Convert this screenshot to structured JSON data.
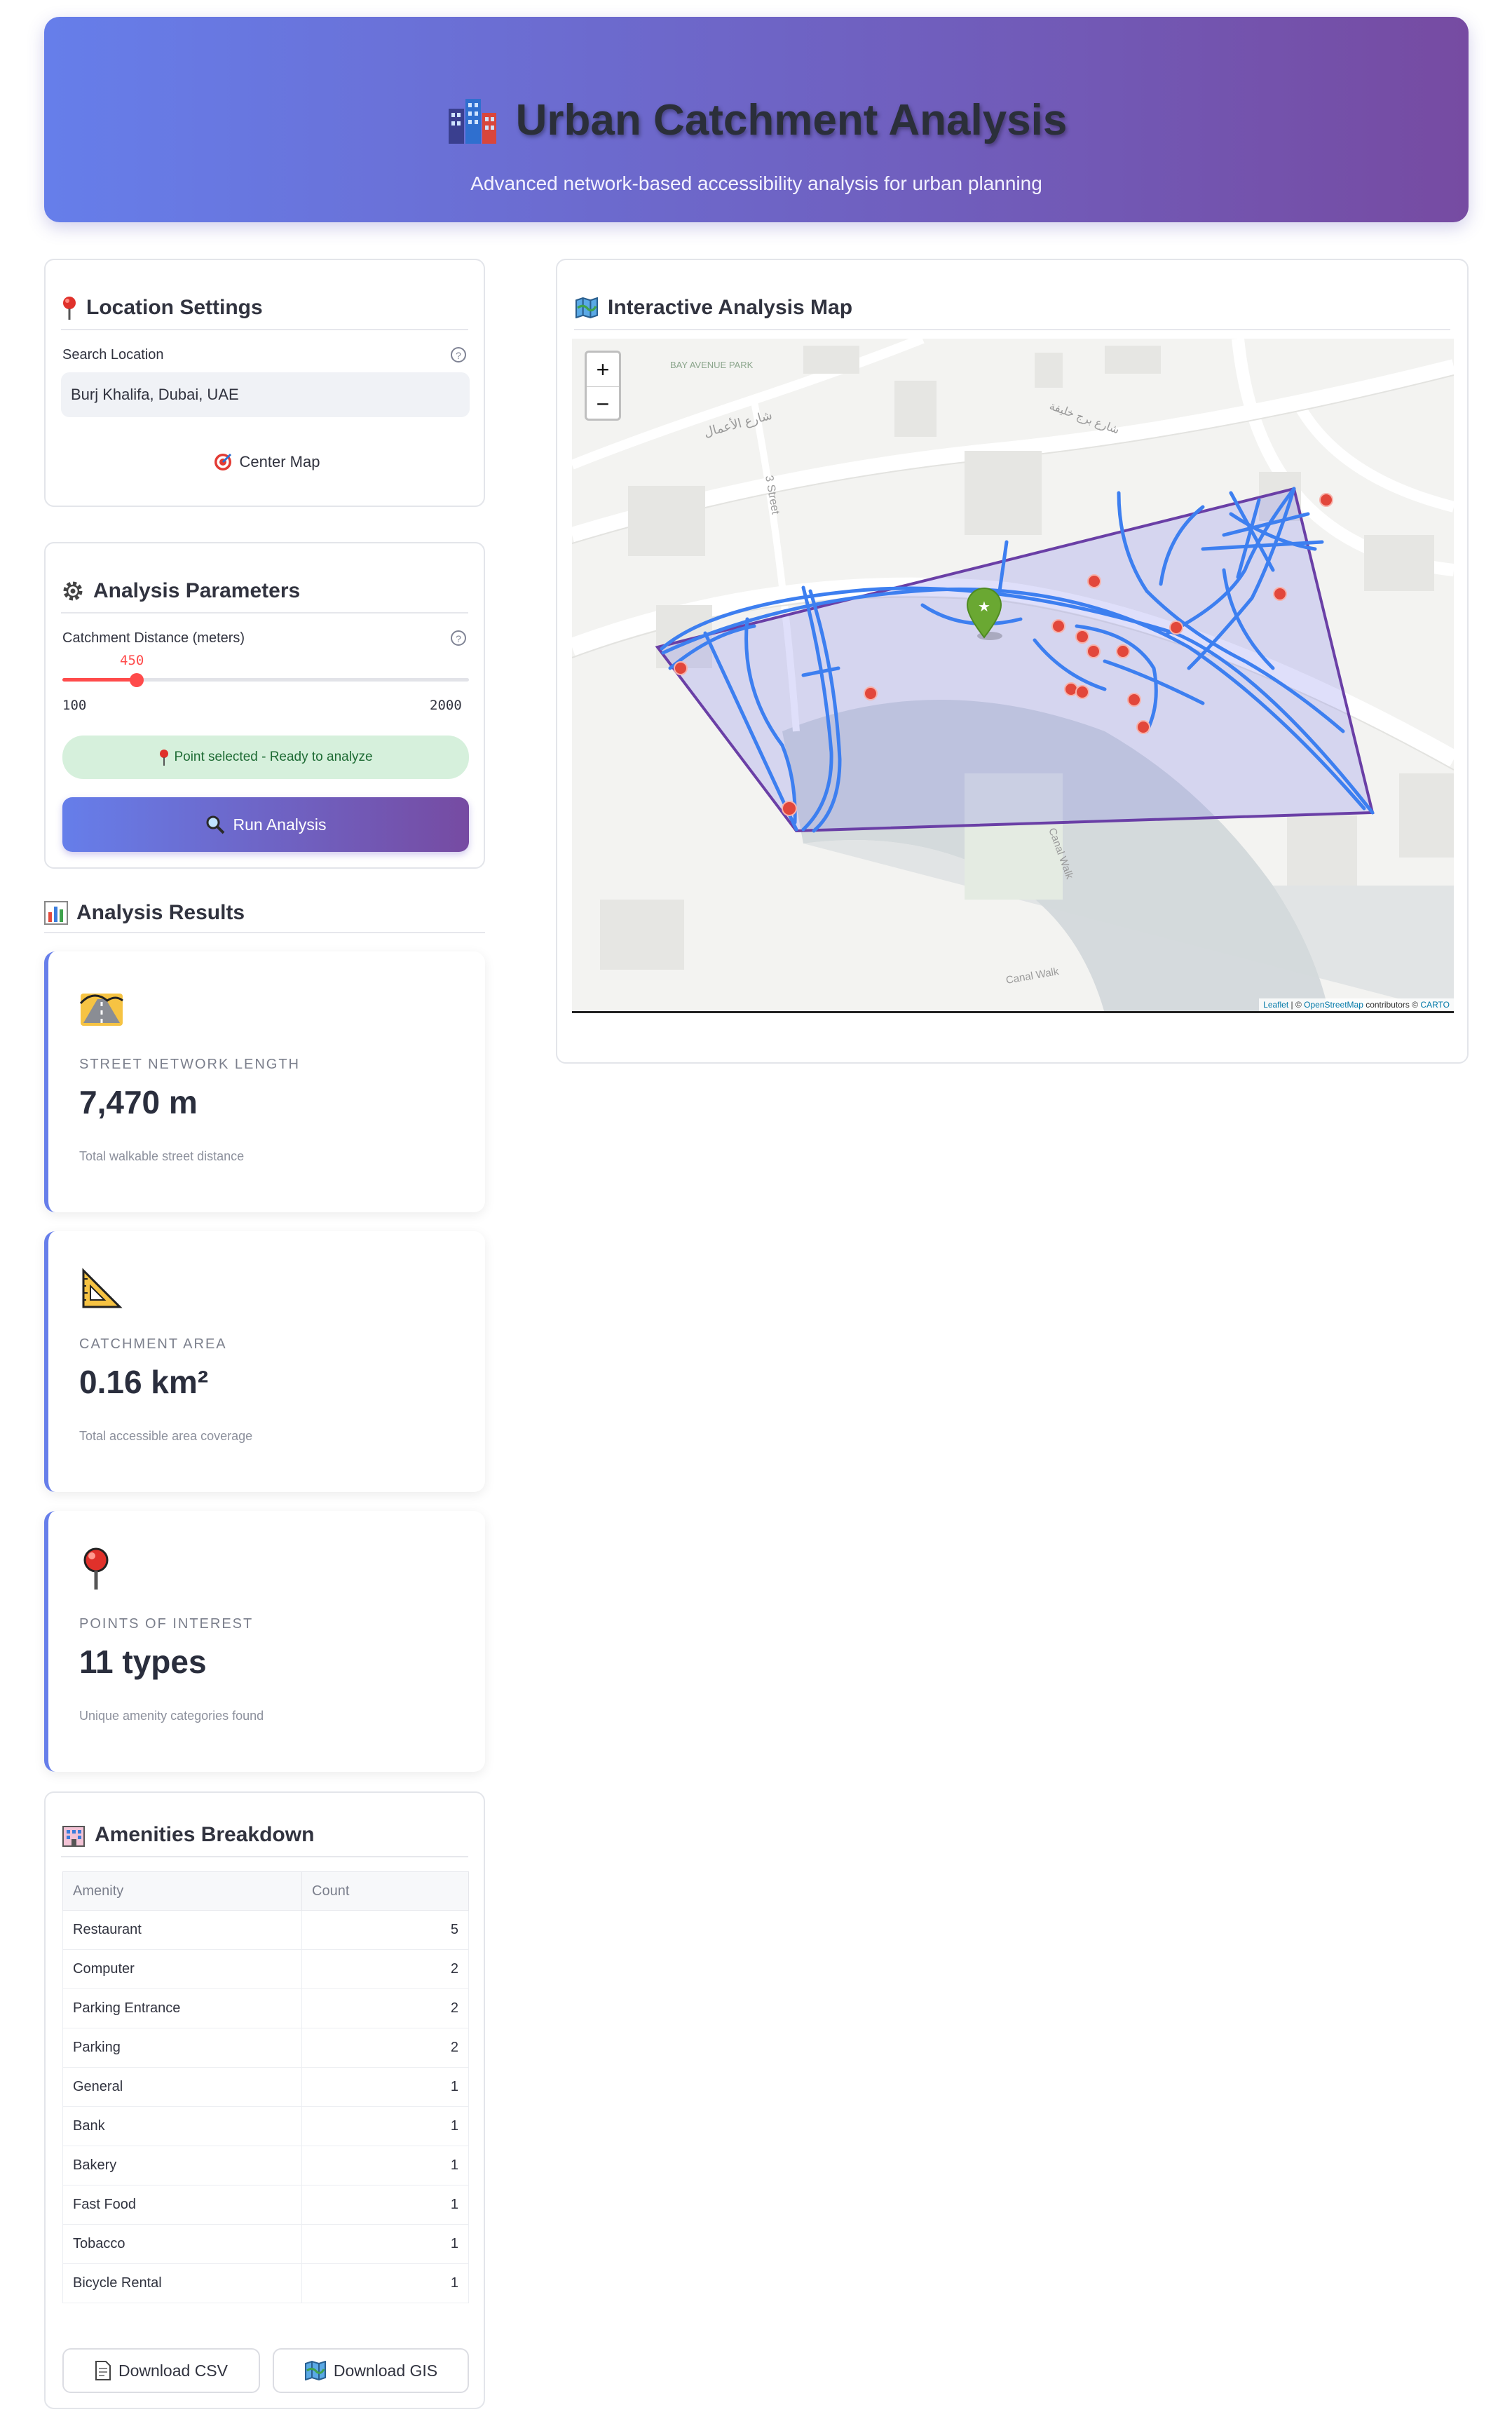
{
  "header": {
    "icon": "city-buildings-icon",
    "title": "Urban Catchment Analysis",
    "subtitle": "Advanced network-based accessibility analysis for urban planning"
  },
  "location_settings": {
    "title": "Location Settings",
    "search_label": "Search Location",
    "search_value": "Burj Khalifa, Dubai, UAE",
    "center_button": "Center Map"
  },
  "analysis_parameters": {
    "title": "Analysis Parameters",
    "distance_label": "Catchment Distance (meters)",
    "slider": {
      "value": 450,
      "min": 100,
      "max": 2000
    },
    "slider_value_text": "450",
    "slider_min_text": "100",
    "slider_max_text": "2000",
    "status": "Point selected - Ready to analyze",
    "run_button": "Run Analysis"
  },
  "results": {
    "title": "Analysis Results",
    "metrics": [
      {
        "icon": "road-icon",
        "label": "STREET NETWORK LENGTH",
        "value": "7,470 m",
        "desc": "Total walkable street distance"
      },
      {
        "icon": "triangle-ruler-icon",
        "label": "CATCHMENT AREA",
        "value": "0.16 km²",
        "desc": "Total accessible area coverage"
      },
      {
        "icon": "pushpin-icon",
        "label": "POINTS OF INTEREST",
        "value": "11 types",
        "desc": "Unique amenity categories found"
      }
    ]
  },
  "amenities": {
    "title": "Amenities Breakdown",
    "columns": [
      "Amenity",
      "Count"
    ],
    "rows": [
      {
        "name": "Restaurant",
        "count": "5"
      },
      {
        "name": "Computer",
        "count": "2"
      },
      {
        "name": "Parking Entrance",
        "count": "2"
      },
      {
        "name": "Parking",
        "count": "2"
      },
      {
        "name": "General",
        "count": "1"
      },
      {
        "name": "Bank",
        "count": "1"
      },
      {
        "name": "Bakery",
        "count": "1"
      },
      {
        "name": "Fast Food",
        "count": "1"
      },
      {
        "name": "Tobacco",
        "count": "1"
      },
      {
        "name": "Bicycle Rental",
        "count": "1"
      }
    ],
    "download_csv": "Download CSV",
    "download_gis": "Download GIS"
  },
  "map": {
    "title": "Interactive Analysis Map",
    "zoom_in": "+",
    "zoom_out": "−",
    "labels": {
      "park": "BAY AVENUE PARK",
      "street_a": "شارع الأعمال",
      "street_b": "3 Street",
      "street_c": "شارع برج خليفة",
      "canal_walk_1": "Canal Walk",
      "canal_walk_2": "Canal Walk"
    },
    "attribution": {
      "leaflet": "Leaflet",
      "sep": " | © ",
      "osm": "OpenStreetMap",
      "mid": " contributors © ",
      "carto": "CARTO"
    },
    "colors": {
      "catchment": "#5b3ea6",
      "streets": "#3d7ff0",
      "poi": "#e2473b",
      "marker": "#6aa832"
    }
  }
}
